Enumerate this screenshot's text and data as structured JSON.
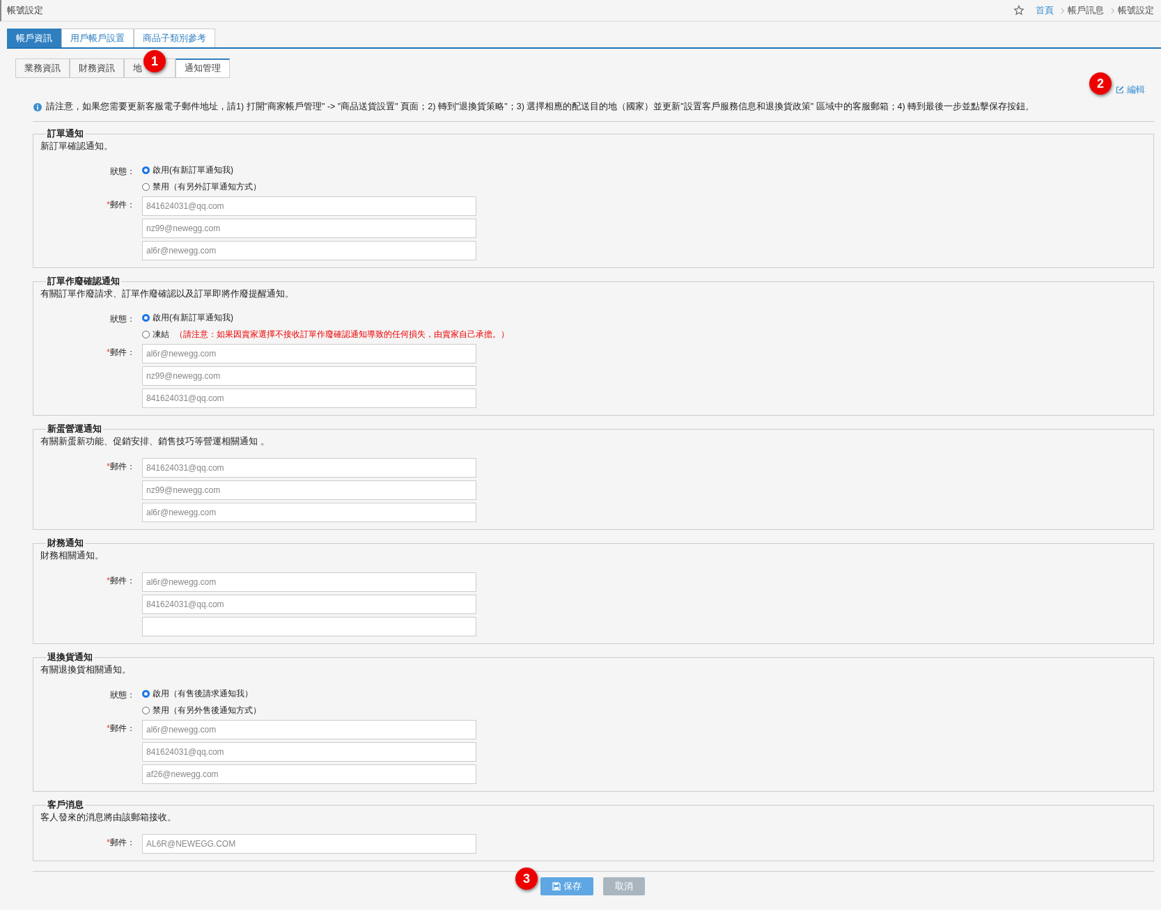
{
  "page_title": "帳號設定",
  "breadcrumb": [
    {
      "label": "首頁",
      "link": true
    },
    {
      "label": "帳戶訊息",
      "link": false
    },
    {
      "label": "帳號設定",
      "link": false
    }
  ],
  "main_tabs": [
    {
      "label": "帳戶資訊",
      "selected": true
    },
    {
      "label": "用戶帳戶設置",
      "selected": false
    },
    {
      "label": "商品子類別參考",
      "selected": false
    }
  ],
  "sub_tabs": [
    {
      "label": "業務資訊",
      "selected": false
    },
    {
      "label": "財務資訊",
      "selected": false
    },
    {
      "label": "地",
      "selected": false
    },
    {
      "label": "通知管理",
      "selected": true
    }
  ],
  "edit_link": "編輯",
  "notice": "請注意，如果您需要更新客服電子郵件地址，請1) 打開\"商家帳戶管理\" -> \"商品送貨設置\" 頁面；2) 轉到\"退換貨策略\"；3) 選擇相應的配送目的地（國家）並更新\"設置客戶服務信息和退換貨政策\" 區域中的客服郵箱；4) 轉到最後一步並點擊保存按鈕。",
  "sections": [
    {
      "title": "訂單通知",
      "description": "新訂單確認通知。",
      "status_label": "狀態：",
      "options": [
        {
          "label": "啟用(有新訂單通知我)",
          "selected": true
        },
        {
          "label": "禁用（有另外訂單通知方式）",
          "selected": false
        }
      ],
      "email_mark": "*",
      "email_label": "郵件：",
      "emails": [
        "841624031@qq.com",
        "nz99@newegg.com",
        "al6r@newegg.com"
      ]
    },
    {
      "title": "訂單作廢確認通知",
      "description": "有關訂單作廢請求、訂單作廢確認以及訂單即將作廢提醒通知。",
      "status_label": "狀態：",
      "options": [
        {
          "label": "啟用(有新訂單通知我)",
          "selected": true
        },
        {
          "label": "凍結",
          "note": "（請注意：如果因賣家選擇不接收訂單作廢確認通知導致的任何損失，由賣家自己承擔。）",
          "selected": false
        }
      ],
      "email_mark": "*",
      "email_label": "郵件：",
      "emails": [
        "al6r@newegg.com",
        "nz99@newegg.com",
        "841624031@qq.com"
      ]
    },
    {
      "title": "新蛋營運通知",
      "description": "有關新蛋新功能、促銷安排、銷售技巧等營運相關通知 。",
      "email_mark": "*",
      "email_label": "郵件：",
      "emails": [
        "841624031@qq.com",
        "nz99@newegg.com",
        "al6r@newegg.com"
      ]
    },
    {
      "title": "財務通知",
      "description": "財務相關通知。",
      "email_mark": "*",
      "email_label": "郵件：",
      "emails": [
        "al6r@newegg.com",
        "841624031@qq.com"
      ],
      "blank_field": true
    },
    {
      "title": "退換貨通知",
      "description": "有關退換貨相關通知。",
      "status_label": "狀態：",
      "options": [
        {
          "label": "啟用（有售後請求通知我）",
          "selected": true
        },
        {
          "label": "禁用（有另外售後通知方式）",
          "selected": false
        }
      ],
      "email_mark": "*",
      "email_label": "郵件：",
      "emails": [
        "al6r@newegg.com",
        "841624031@qq.com",
        "af26@newegg.com"
      ]
    },
    {
      "title": "客戶消息",
      "description": "客人發來的消息將由該郵箱接收。",
      "email_mark": "*",
      "email_label": "郵件：",
      "emails": [
        "AL6R@NEWEGG.COM"
      ]
    }
  ],
  "buttons": [
    {
      "label": "保存",
      "kind": "primary"
    },
    {
      "label": "取消",
      "kind": "secondary"
    }
  ],
  "callouts": [
    "1",
    "2",
    "3"
  ]
}
